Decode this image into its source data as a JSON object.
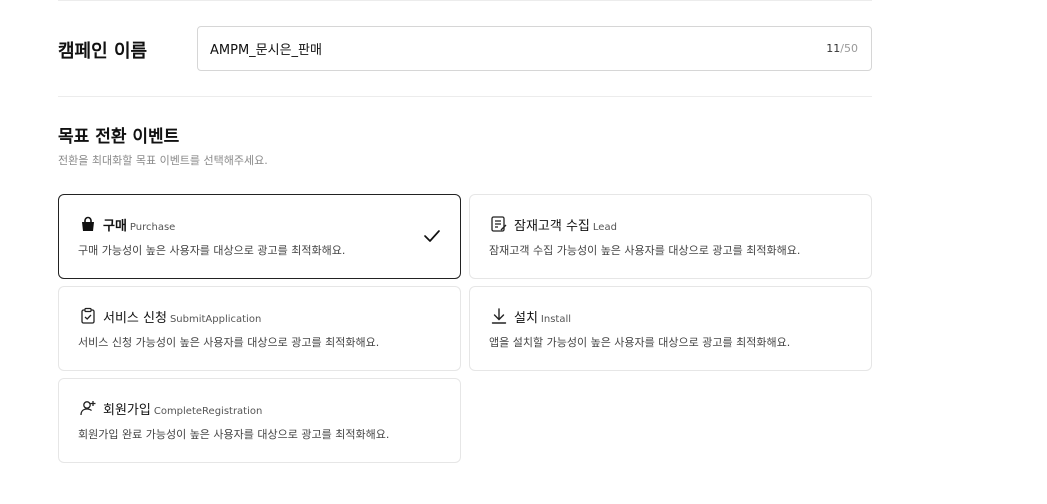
{
  "campaign": {
    "label": "캠페인 이름",
    "value": "AMPM_문시은_판매",
    "count_current": "11",
    "count_sep_max": "/50"
  },
  "goal": {
    "title": "목표 전환 이벤트",
    "description": "전환을 최대화할 목표 이벤트를 선택해주세요.",
    "options": [
      {
        "title": "구매",
        "sub": "Purchase",
        "desc": "구매 가능성이 높은 사용자를 대상으로 광고를 최적화해요.",
        "icon": "shopping-bag-icon",
        "selected": true
      },
      {
        "title": "잠재고객 수집",
        "sub": "Lead",
        "desc": "잠재고객 수집 가능성이 높은 사용자를 대상으로 광고를 최적화해요.",
        "icon": "form-edit-icon",
        "selected": false
      },
      {
        "title": "서비스 신청",
        "sub": "SubmitApplication",
        "desc": "서비스 신청 가능성이 높은 사용자를 대상으로 광고를 최적화해요.",
        "icon": "clipboard-check-icon",
        "selected": false
      },
      {
        "title": "설치",
        "sub": "Install",
        "desc": "앱을 설치할 가능성이 높은 사용자를 대상으로 광고를 최적화해요.",
        "icon": "download-icon",
        "selected": false
      },
      {
        "title": "회원가입",
        "sub": "CompleteRegistration",
        "desc": "회원가입 완료 가능성이 높은 사용자를 대상으로 광고를 최적화해요.",
        "icon": "user-add-icon",
        "selected": false
      }
    ]
  }
}
